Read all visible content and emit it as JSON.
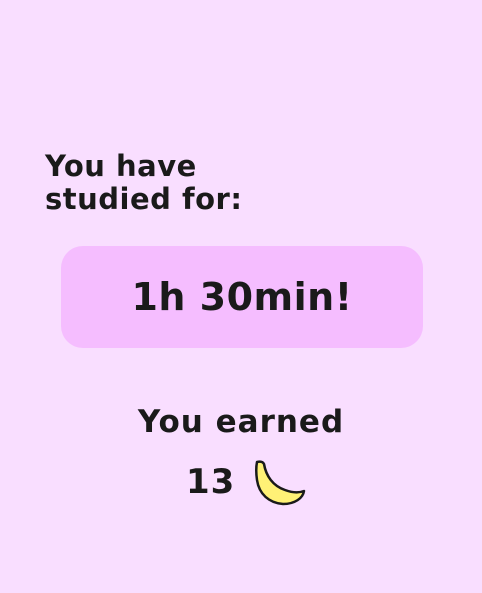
{
  "summary": {
    "line1": "You have",
    "line2": "studied for:"
  },
  "duration": {
    "text": "1h 30min!"
  },
  "reward": {
    "label": "You earned",
    "count": "13",
    "icon": "banana-icon",
    "icon_color": "#FFF176"
  },
  "colors": {
    "background": "#F9DEFF",
    "card": "#F5BDFF"
  }
}
